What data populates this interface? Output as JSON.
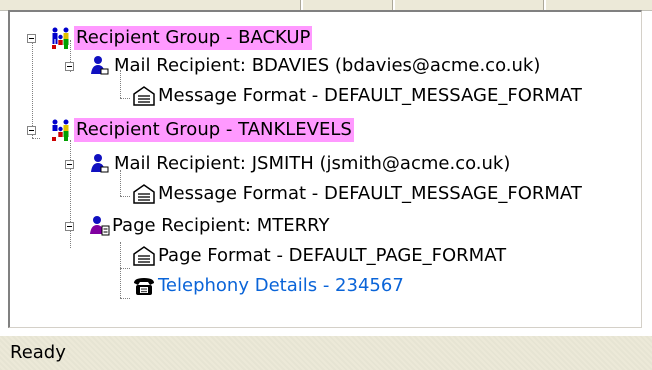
{
  "tree": {
    "groups": [
      {
        "label": "Recipient Group - BACKUP",
        "children": [
          {
            "label": "Mail Recipient: BDAVIES (bdavies@acme.co.uk)",
            "children": [
              {
                "label": "Message Format - DEFAULT_MESSAGE_FORMAT"
              }
            ]
          }
        ]
      },
      {
        "label": "Recipient Group - TANKLEVELS",
        "children": [
          {
            "label": "Mail Recipient: JSMITH (jsmith@acme.co.uk)",
            "children": [
              {
                "label": "Message Format - DEFAULT_MESSAGE_FORMAT"
              }
            ]
          },
          {
            "label": "Page Recipient: MTERRY",
            "children": [
              {
                "label": "Page Format - DEFAULT_PAGE_FORMAT"
              },
              {
                "label": "Telephony Details - 234567"
              }
            ]
          }
        ]
      }
    ]
  },
  "status": {
    "text": "Ready"
  },
  "colors": {
    "group_highlight": "#ff99ff",
    "link": "#0a64d8"
  },
  "icons": {
    "group": "recipient-group-icon",
    "mail": "mail-recipient-icon",
    "page": "page-recipient-icon",
    "format": "message-format-icon",
    "telephony": "telephony-icon",
    "toggle": "collapse-toggle"
  }
}
